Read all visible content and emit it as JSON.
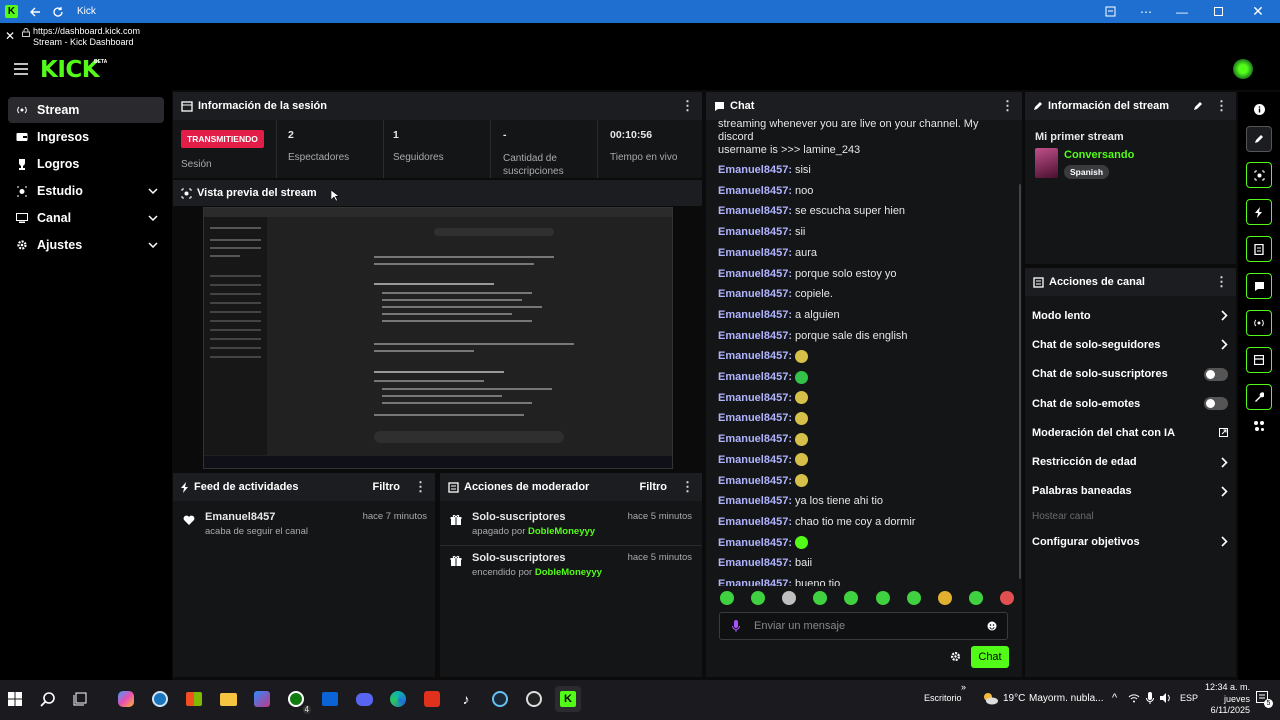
{
  "window": {
    "title": "Kick"
  },
  "address": {
    "url": "https://dashboard.kick.com",
    "page_title": "Stream - Kick Dashboard"
  },
  "brand": {
    "logo": "KICK",
    "beta": "BETA",
    "green": "#53fc18"
  },
  "sidebar": {
    "items": [
      {
        "label": "Stream",
        "icon": "stream-icon",
        "active": true
      },
      {
        "label": "Ingresos",
        "icon": "wallet-icon"
      },
      {
        "label": "Logros",
        "icon": "trophy-icon"
      },
      {
        "label": "Estudio",
        "icon": "studio-icon",
        "chevron": true
      },
      {
        "label": "Canal",
        "icon": "channel-icon",
        "chevron": true
      },
      {
        "label": "Ajustes",
        "icon": "gear-icon",
        "chevron": true
      }
    ]
  },
  "session": {
    "title": "Información de la sesión",
    "status": "TRANSMITIENDO",
    "status_label": "Sesión",
    "stats": [
      {
        "value": "2",
        "label": "Espectadores"
      },
      {
        "value": "1",
        "label": "Seguidores"
      },
      {
        "value": "-",
        "label": "Cantidad de suscripciones"
      },
      {
        "value": "00:10:56",
        "label": "Tiempo en vivo"
      }
    ]
  },
  "preview": {
    "title": "Vista previa del stream"
  },
  "activity": {
    "title": "Feed de actividades",
    "filter": "Filtro",
    "items": [
      {
        "user": "Emanuel8457",
        "text": "acaba de seguir el canal",
        "time": "hace 7 minutos"
      }
    ]
  },
  "modactions": {
    "title": "Acciones de moderador",
    "filter": "Filtro",
    "items": [
      {
        "title": "Solo-suscriptores",
        "action": "apagado por",
        "by": "DobleMoneyyy",
        "time": "hace 5 minutos"
      },
      {
        "title": "Solo-suscriptores",
        "action": "encendido por",
        "by": "DobleMoneyyy",
        "time": "hace 5 minutos"
      }
    ]
  },
  "chat": {
    "title": "Chat",
    "first_line": "streaming whenever you are live on your channel. My discord",
    "second_line": "username is >>> lamine_243",
    "messages": [
      {
        "user": "Emanuel8457:",
        "text": "sisi"
      },
      {
        "user": "Emanuel8457:",
        "text": "noo"
      },
      {
        "user": "Emanuel8457:",
        "text": "se escucha super hien"
      },
      {
        "user": "Emanuel8457:",
        "text": "sii"
      },
      {
        "user": "Emanuel8457:",
        "text": "aura"
      },
      {
        "user": "Emanuel8457:",
        "text": "porque solo estoy yo"
      },
      {
        "user": "Emanuel8457:",
        "text": "copiele."
      },
      {
        "user": "Emanuel8457:",
        "text": "a alguien"
      },
      {
        "user": "Emanuel8457:",
        "text": "porque sale dis english"
      },
      {
        "user": "Emanuel8457:",
        "text": "",
        "emote": "#d6c04a"
      },
      {
        "user": "Emanuel8457:",
        "text": "",
        "emote": "#35c24a"
      },
      {
        "user": "Emanuel8457:",
        "text": "",
        "emote": "#d6c04a"
      },
      {
        "user": "Emanuel8457:",
        "text": "",
        "emote": "#d6c04a"
      },
      {
        "user": "Emanuel8457:",
        "text": "",
        "emote": "#d6c04a"
      },
      {
        "user": "Emanuel8457:",
        "text": "",
        "emote": "#d6c04a"
      },
      {
        "user": "Emanuel8457:",
        "text": "",
        "emote": "#d6c04a"
      },
      {
        "user": "Emanuel8457:",
        "text": "ya los tiene ahi tio"
      },
      {
        "user": "Emanuel8457:",
        "text": "chao tio me coy a dormir"
      },
      {
        "user": "Emanuel8457:",
        "text": "",
        "emote": "#53fc18"
      },
      {
        "user": "Emanuel8457:",
        "text": "baii"
      },
      {
        "user": "Emanuel8457:",
        "text": "bueno tio"
      }
    ],
    "emote_bar": [
      "#3fd13f",
      "#3fd13f",
      "#bfbfbf",
      "#3fd13f",
      "#3fd13f",
      "#3fd13f",
      "#3fd13f",
      "#e0b030",
      "#3fd13f",
      "#e05050"
    ],
    "placeholder": "Enviar un mensaje",
    "send": "Chat"
  },
  "streaminfo": {
    "title": "Información del stream",
    "name": "Mi primer stream",
    "category": "Conversando",
    "tag": "Spanish"
  },
  "channel": {
    "title": "Acciones de canal",
    "items": [
      {
        "label": "Modo lento",
        "ctl": "chevron"
      },
      {
        "label": "Chat de solo-seguidores",
        "ctl": "chevron"
      },
      {
        "label": "Chat de solo-suscriptores",
        "ctl": "toggle"
      },
      {
        "label": "Chat de solo-emotes",
        "ctl": "toggle"
      },
      {
        "label": "Moderación del chat con IA",
        "ctl": "external"
      },
      {
        "label": "Restricción de edad",
        "ctl": "chevron"
      },
      {
        "label": "Palabras baneadas",
        "ctl": "chevron"
      },
      {
        "label": "Hostear canal",
        "ctl": "none",
        "disabled": true
      },
      {
        "label": "Configurar objetivos",
        "ctl": "chevron"
      }
    ]
  },
  "taskbar": {
    "desktop": "Escritorio",
    "temp": "19°C",
    "weather": "Mayorm. nubla...",
    "lang": "ESP",
    "time": "12:34 a. m.",
    "day": "jueves",
    "date": "6/11/2025",
    "badge": "4",
    "notif": "5"
  }
}
